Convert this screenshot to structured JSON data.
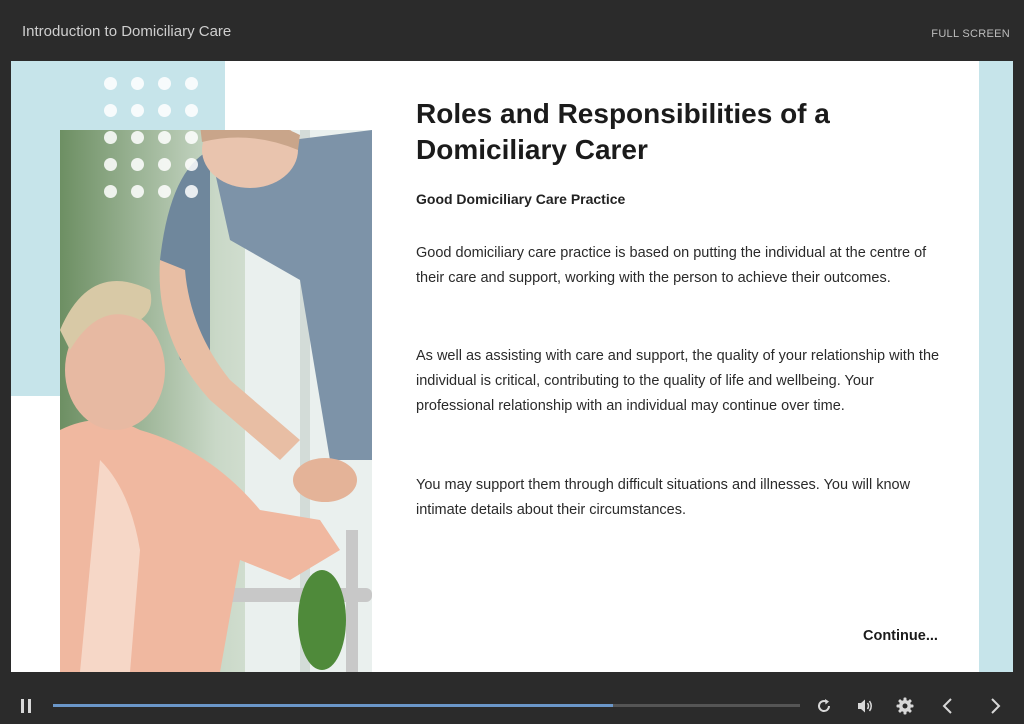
{
  "header": {
    "course_title": "Introduction to Domiciliary Care",
    "fullscreen_label": "FULL SCREEN"
  },
  "slide": {
    "title": "Roles and Responsibilities of a Domiciliary Carer",
    "subtitle": "Good Domiciliary Care Practice",
    "paragraphs": [
      "Good domiciliary care practice is based on putting the individual at the centre of their care and support, working with the person to achieve their outcomes.",
      "As well as assisting with care and support, the quality of your relationship with the individual is critical, contributing to the quality of life and wellbeing. Your professional relationship with an individual may continue over time.",
      "You may support them through difficult situations and illnesses. You will know intimate details about their circumstances."
    ],
    "continue_label": "Continue..."
  },
  "player": {
    "progress_percent": 75,
    "icons": [
      "pause-icon",
      "replay-icon",
      "volume-icon",
      "gear-icon",
      "chevron-left-icon",
      "chevron-right-icon"
    ]
  },
  "colors": {
    "accent_light_blue": "#c6e4ea",
    "progress_blue": "#6b97c9",
    "chrome": "#2b2b2b"
  }
}
